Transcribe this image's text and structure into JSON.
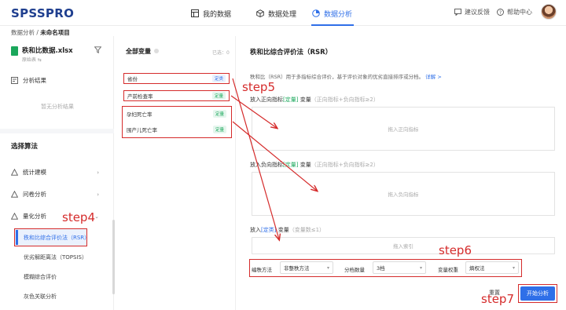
{
  "app": {
    "logo": "SPSSPRO"
  },
  "nav": {
    "my_data": "我的数据",
    "data_processing": "数据处理",
    "data_analysis": "数据分析",
    "feedback": "建议反馈",
    "help": "帮助中心"
  },
  "breadcrumb": {
    "root": "数据分析",
    "sep": " / ",
    "current": "未命名项目"
  },
  "sidebar": {
    "file_name": "秩和比数据.xlsx",
    "file_sub": "原始表  ⇆",
    "results_label": "分析结果",
    "no_results": "暂无分析结果",
    "choose_algo": "选择算法",
    "categories": [
      {
        "label": "统计建模"
      },
      {
        "label": "问卷分析"
      },
      {
        "label": "量化分析"
      }
    ],
    "sub_items": [
      "秩和比综合评价法（RSR）",
      "优劣解距离法（TOPSIS）",
      "模糊综合评价",
      "灰色关联分析"
    ]
  },
  "var_panel": {
    "title": "全部变量",
    "selected": "已选：0",
    "variables": [
      {
        "name": "省份",
        "type": "定类"
      },
      {
        "name": "产前检查率",
        "type": "定量"
      },
      {
        "name": "孕妇死亡率",
        "type": "定量"
      },
      {
        "name": "围产儿死亡率",
        "type": "定量"
      }
    ]
  },
  "main": {
    "title": "秩和比综合评价法（RSR）",
    "desc": "秩和比（RSR）用于多指标综合评价，基于评价对象的优劣直接排序或分档。",
    "desc_link": "详解 >",
    "pos_label_pre": "放入正向指标",
    "pos_label_tag": "[定量]",
    "pos_label_post": " 变量",
    "pos_hint": "（正向指标+负向指标≥2）",
    "pos_placeholder": "拖入正向指标",
    "neg_label_pre": "放入负向指标",
    "neg_label_tag": "[定量]",
    "neg_label_post": " 变量",
    "neg_hint": "（正向指标+负向指标≥2）",
    "neg_placeholder": "拖入负向指标",
    "idx_label_pre": "放入",
    "idx_label_tag": "[定类]",
    "idx_label_post": " 变量",
    "idx_hint": "（变量数≤1）",
    "idx_placeholder": "拖入索引",
    "params": {
      "rank_method_label": "编秩方法",
      "rank_method_value": "非整秩方法",
      "bins_label": "分档数量",
      "bins_value": "3档",
      "weight_label": "变量权重",
      "weight_value": "熵权法"
    },
    "reset": "重置",
    "start": "开始分析"
  },
  "steps": {
    "step4": "step4",
    "step5": "step5",
    "step6": "step6",
    "step7": "step7"
  },
  "colors": {
    "accent": "#2f6fe8",
    "annotation": "#d52b2b",
    "quant_tag": "#1aa75b"
  }
}
